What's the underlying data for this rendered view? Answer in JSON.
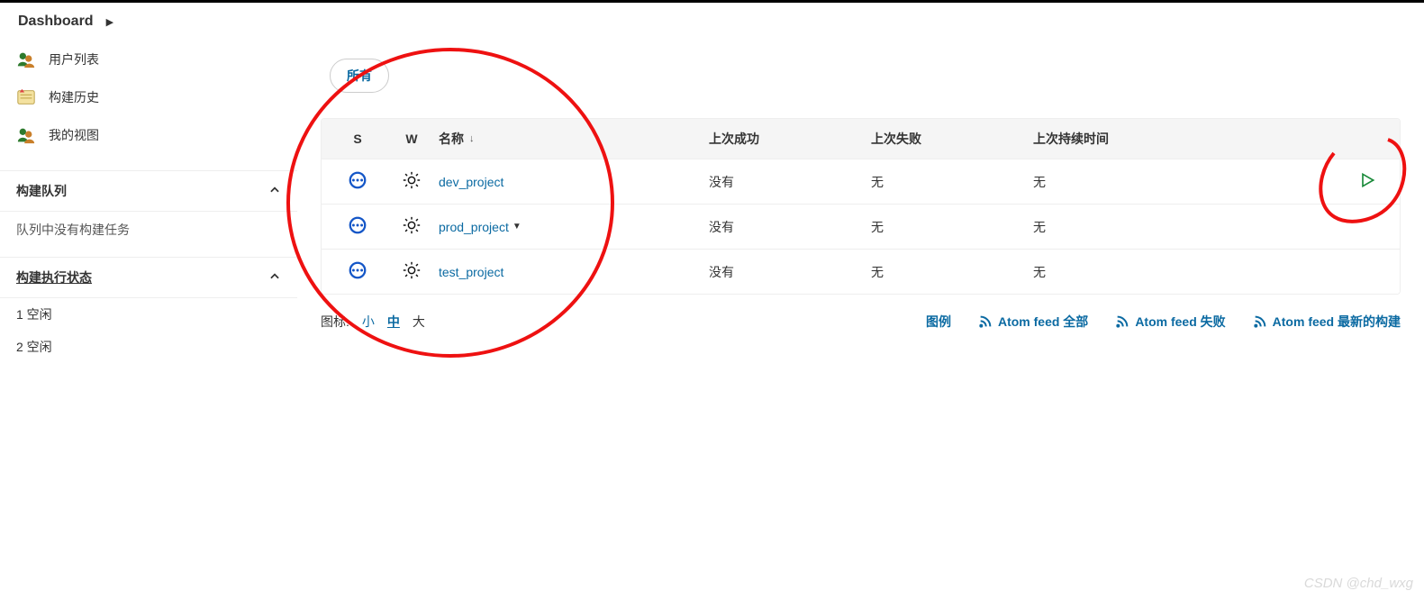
{
  "header": {
    "title": "Dashboard"
  },
  "sidebar": {
    "links": [
      {
        "label": "用户列表"
      },
      {
        "label": "构建历史"
      },
      {
        "label": "我的视图"
      }
    ],
    "buildQueue": {
      "title": "构建队列",
      "empty": "队列中没有构建任务"
    },
    "execStatus": {
      "title": "构建执行状态",
      "items": [
        {
          "id": "1",
          "text": "空闲"
        },
        {
          "id": "2",
          "text": "空闲"
        }
      ]
    }
  },
  "tabs": {
    "all": "所有"
  },
  "table": {
    "headers": {
      "s": "S",
      "w": "W",
      "name": "名称",
      "lastSuccess": "上次成功",
      "lastFailure": "上次失败",
      "lastDuration": "上次持续时间"
    },
    "rows": [
      {
        "name": "dev_project",
        "hasDropdown": false,
        "lastSuccess": "没有",
        "lastFailure": "无",
        "lastDuration": "无",
        "showRun": true
      },
      {
        "name": "prod_project",
        "hasDropdown": true,
        "lastSuccess": "没有",
        "lastFailure": "无",
        "lastDuration": "无",
        "showRun": false
      },
      {
        "name": "test_project",
        "hasDropdown": false,
        "lastSuccess": "没有",
        "lastFailure": "无",
        "lastDuration": "无",
        "showRun": false
      }
    ]
  },
  "footer": {
    "iconLabel": "图标:",
    "sizes": {
      "small": "小",
      "medium": "中",
      "large": "大"
    },
    "legend": "图例",
    "feedAll": "Atom feed 全部",
    "feedFail": "Atom feed 失败",
    "feedLatest": "Atom feed 最新的构建"
  },
  "watermark": "CSDN @chd_wxg"
}
